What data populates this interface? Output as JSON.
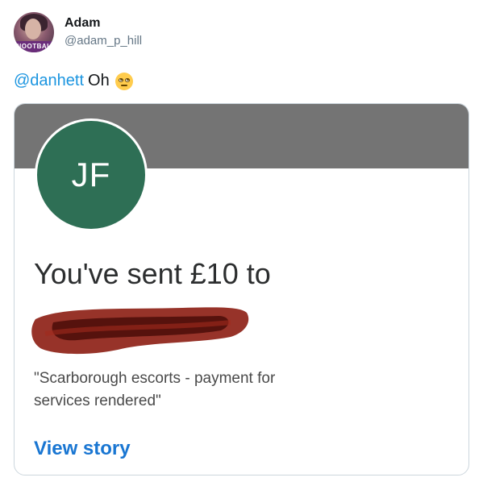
{
  "tweet": {
    "author": {
      "name": "Adam",
      "handle": "@adam_p_hill",
      "avatar_badge": "NOOTBAL"
    },
    "mention": "@danhett",
    "text": "Oh",
    "emoji": "face-with-rolling-eyes"
  },
  "card": {
    "banner_color": "#747474",
    "avatar_initials": "JF",
    "avatar_color": "#2e6f55",
    "heading": "You've sent £10 to",
    "recipient_redacted": true,
    "note": "\"Scarborough escorts - payment for services rendered\"",
    "link_label": "View story",
    "link_color": "#1976d2"
  }
}
